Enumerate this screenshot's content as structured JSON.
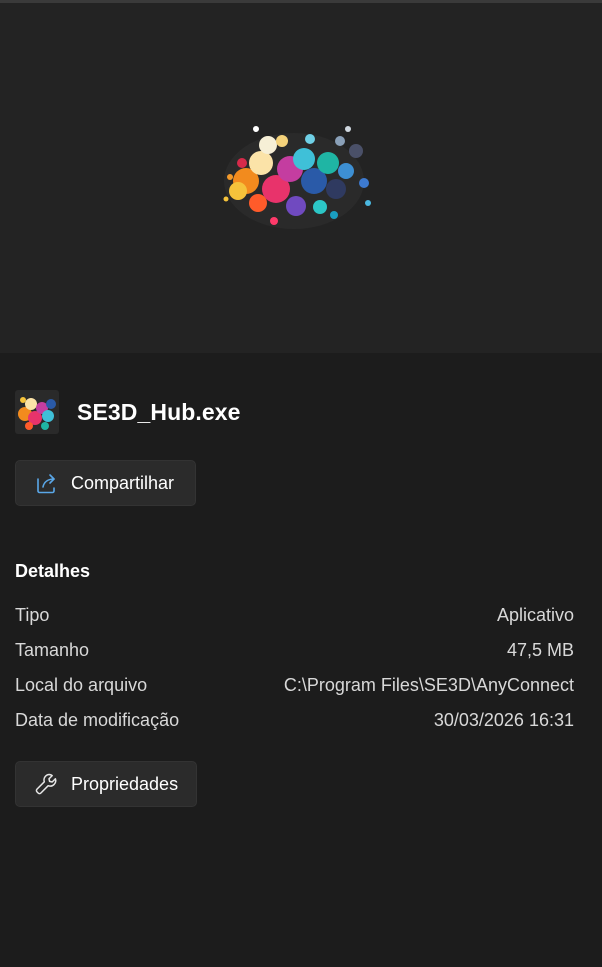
{
  "file": {
    "name": "SE3D_Hub.exe"
  },
  "actions": {
    "share_label": "Compartilhar",
    "properties_label": "Propriedades"
  },
  "details": {
    "title": "Detalhes",
    "rows": [
      {
        "label": "Tipo",
        "value": "Aplicativo"
      },
      {
        "label": "Tamanho",
        "value": "47,5 MB"
      },
      {
        "label": "Local do arquivo",
        "value": "C:\\Program Files\\SE3D\\AnyConnect"
      },
      {
        "label": "Data de modificação",
        "value": "30/03/2026 16:31"
      }
    ]
  },
  "icons": {
    "share": "share-icon",
    "properties": "wrench-icon",
    "file_thumbnail": "app-thumbnail-icon"
  },
  "colors": {
    "pane_background": "#1c1c1c",
    "preview_background": "#232323",
    "button_background": "#2b2b2b",
    "accent": "#5aa7e8"
  }
}
